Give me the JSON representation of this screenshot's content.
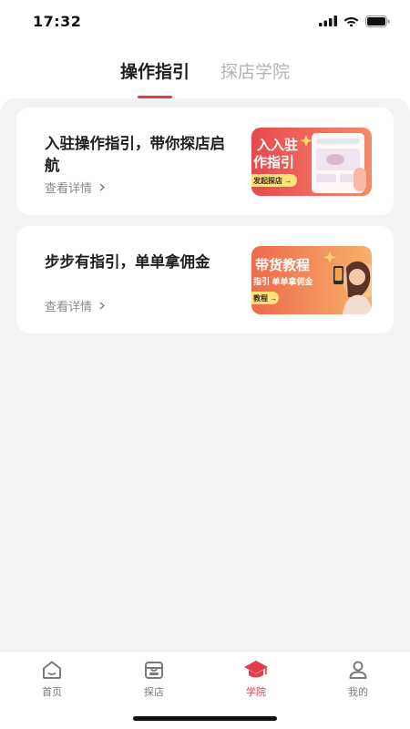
{
  "status_bar": {
    "time": "17:32",
    "icons": [
      "signal-icon",
      "wifi-icon",
      "battery-icon"
    ]
  },
  "tabs": [
    {
      "label": "操作指引",
      "active": true
    },
    {
      "label": "探店学院",
      "active": false
    }
  ],
  "cards": [
    {
      "title": "入驻操作指引，带你探店启航",
      "link": "查看详情",
      "thumb": {
        "line1": "入入驻",
        "line2": "作指引",
        "button": "发起探店 →"
      }
    },
    {
      "title": "步步有指引，单单拿佣金",
      "link": "查看详情",
      "thumb": {
        "line1": "带货教程",
        "line2": "指引 单单拿佣金",
        "button": "教程 →"
      }
    }
  ],
  "bottom_nav": [
    {
      "label": "首页",
      "icon": "home-icon",
      "active": false
    },
    {
      "label": "探店",
      "icon": "store-icon",
      "active": false
    },
    {
      "label": "学院",
      "icon": "graduation-cap-icon",
      "active": true
    },
    {
      "label": "我的",
      "icon": "profile-icon",
      "active": false
    }
  ],
  "colors": {
    "accent": "#e23b4a",
    "background": "#f3f3f6",
    "card": "#ffffff",
    "thumb_red": "#ee5a62",
    "thumb_orange": "#f59a52"
  }
}
